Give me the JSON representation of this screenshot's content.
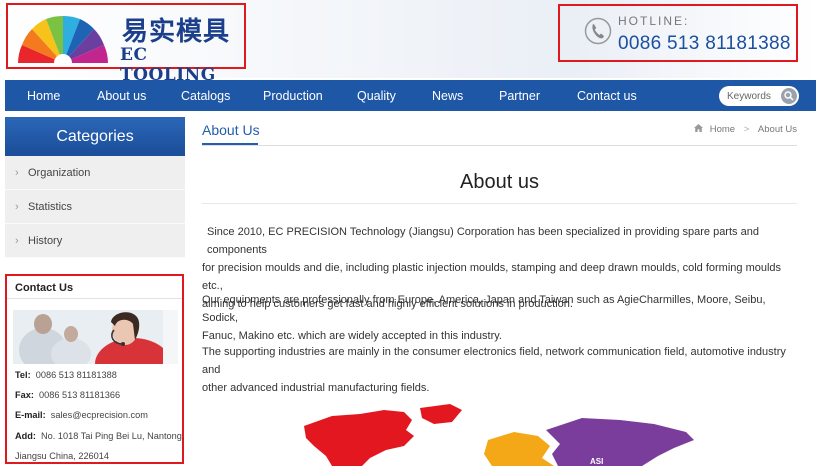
{
  "header": {
    "logo_cn": "易实模具",
    "logo_en": "EC TOOLING",
    "hotline_label": "HOTLINE:",
    "hotline_number": "0086 513 81181388"
  },
  "nav": {
    "items": [
      "Home",
      "About us",
      "Catalogs",
      "Production",
      "Quality",
      "News",
      "Partner",
      "Contact us"
    ],
    "search_placeholder": "Keywords"
  },
  "sidebar": {
    "title": "Categories",
    "items": [
      "Organization",
      "Statistics",
      "History"
    ]
  },
  "contact": {
    "title": "Contact Us",
    "tel_label": "Tel:",
    "tel": "0086 513 81181388",
    "fax_label": "Fax:",
    "fax": "0086 513 81181366",
    "email_label": "E-mail:",
    "email": "sales@ecprecision.com",
    "add_label": "Add:",
    "address_line1": "No. 1018 Tai Ping Bei Lu, Nantong,",
    "address_line2": "Jiangsu China, 226014"
  },
  "content": {
    "tab": "About Us",
    "breadcrumb_home": "Home",
    "breadcrumb_sep": ">",
    "breadcrumb_current": "About Us",
    "title": "About us",
    "para1_line1": "Since 2010, EC PRECISION Technology (Jiangsu) Corporation has been specialized in providing spare parts and components",
    "para1_line2": "for precision moulds and die, including plastic injection moulds, stamping and deep drawn moulds, cold forming moulds etc.,",
    "para1_line3": "aiming to help customers get fast and highly efficient solutions in production.",
    "para2_line1": "Our equipments are professionally from Europe, America, Japan and Taiwan such as AgieCharmilles, Moore, Seibu, Sodick,",
    "para2_line2": "Fanuc, Makino etc. which are widely accepted in this industry.",
    "para3_line1": "The supporting industries are mainly in the consumer electronics field, network communication field, automotive industry and",
    "para3_line2": "other advanced industrial manufacturing fields.",
    "map_label": "ASI"
  },
  "colors": {
    "brand_blue": "#1e57a6",
    "highlight_red": "#e0191e"
  },
  "icons": [
    "phone-icon",
    "search-icon",
    "home-icon",
    "chevron-right-icon"
  ]
}
